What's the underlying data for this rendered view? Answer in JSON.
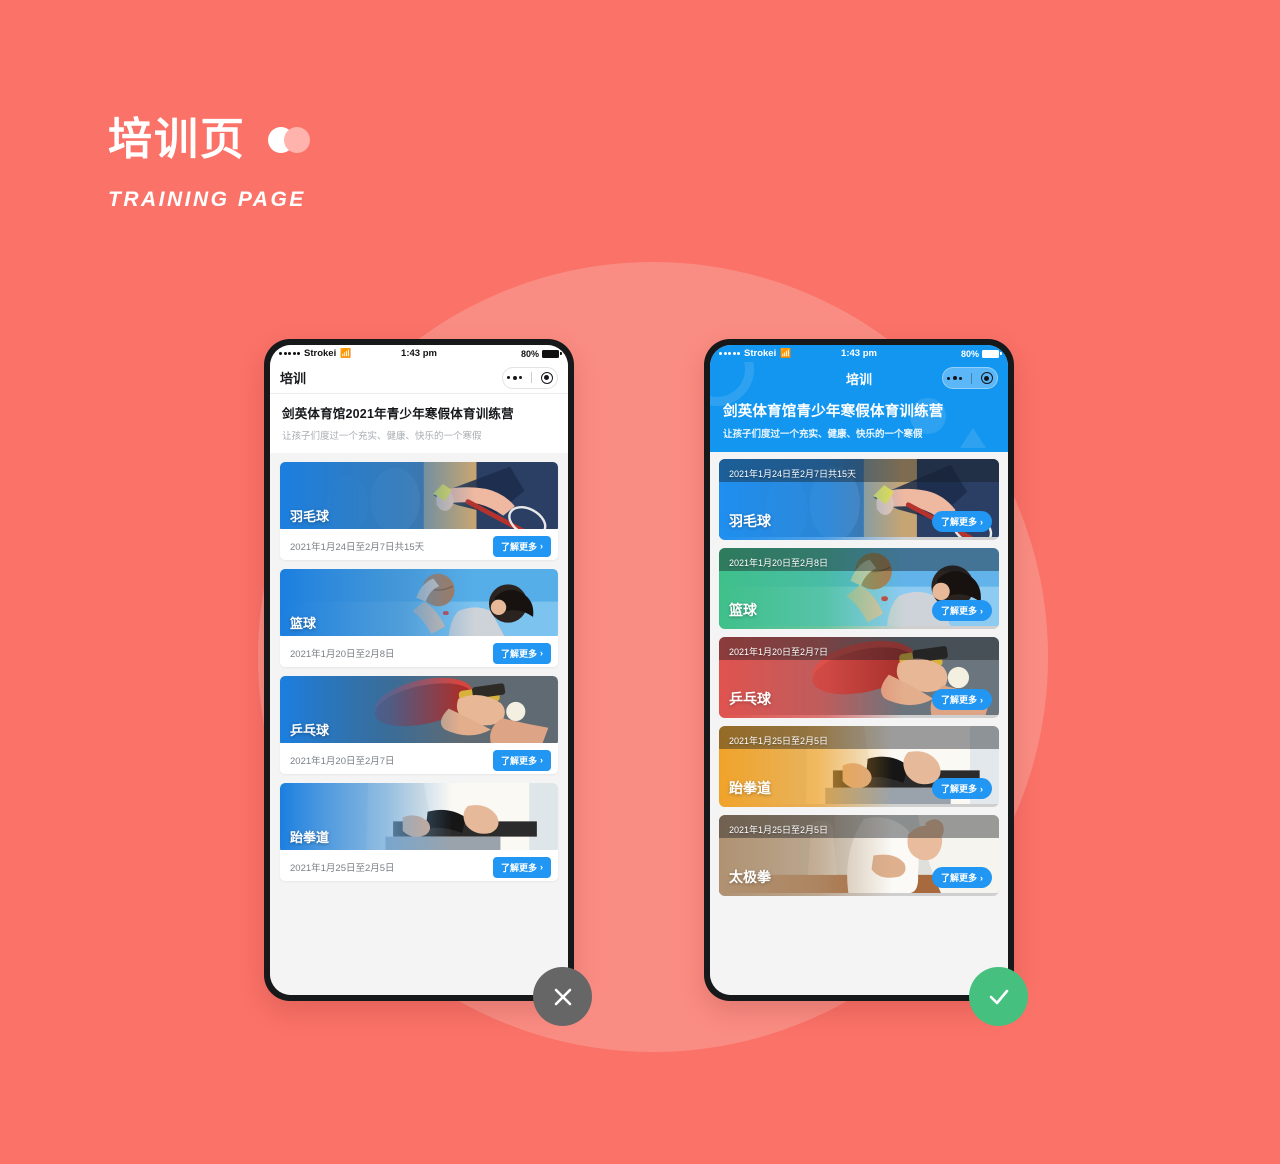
{
  "heading": {
    "title": "培训页",
    "subtitle": "TRAINING PAGE",
    "accent_color": "#fa7268",
    "circle_color": "#fa8d83"
  },
  "status_bar": {
    "carrier": "Strokei",
    "wifi_icon": "wifi-icon",
    "time": "1:43 pm",
    "battery": "80%"
  },
  "phone_left": {
    "nav": {
      "title": "培训",
      "capsule_more_icon": "more-dots-icon",
      "capsule_target_icon": "target-circle-icon"
    },
    "hero": {
      "title": "剑英体育馆2021年青少年寒假体育训练营",
      "subtitle": "让孩子们度过一个充实、健康、快乐的一个寒假"
    },
    "cards": [
      {
        "name": "羽毛球",
        "date": "2021年1月24日至2月7日共15天",
        "button": "了解更多",
        "chevron": "›"
      },
      {
        "name": "篮球",
        "date": "2021年1月20日至2月8日",
        "button": "了解更多",
        "chevron": "›"
      },
      {
        "name": "乒乓球",
        "date": "2021年1月20日至2月7日",
        "button": "了解更多",
        "chevron": "›"
      },
      {
        "name": "跆拳道",
        "date": "2021年1月25日至2月5日",
        "button": "了解更多",
        "chevron": "›"
      }
    ]
  },
  "phone_right": {
    "nav": {
      "title": "培训",
      "capsule_more_icon": "more-dots-icon",
      "capsule_target_icon": "target-circle-icon"
    },
    "hero": {
      "title": "剑英体育馆青少年寒假体育训练营",
      "subtitle": "让孩子们度过一个充实、健康、快乐的一个寒假",
      "background_color": "#1296f0"
    },
    "cards": [
      {
        "name": "羽毛球",
        "date": "2021年1月24日至2月7日共15天",
        "button": "了解更多",
        "chevron": "›",
        "tint": "#1f8ff0"
      },
      {
        "name": "篮球",
        "date": "2021年1月20日至2月8日",
        "button": "了解更多",
        "chevron": "›",
        "tint": "#3fc08a"
      },
      {
        "name": "乒乓球",
        "date": "2021年1月20日至2月7日",
        "button": "了解更多",
        "chevron": "›",
        "tint": "#e0534f"
      },
      {
        "name": "跆拳道",
        "date": "2021年1月25日至2月5日",
        "button": "了解更多",
        "chevron": "›",
        "tint": "#f0a32a"
      },
      {
        "name": "太极拳",
        "date": "2021年1月25日至2月5日",
        "button": "了解更多",
        "chevron": "›",
        "tint": "#b09272"
      }
    ]
  },
  "fabs": {
    "close_label": "close-icon",
    "close_color": "#666666",
    "check_label": "check-icon",
    "check_color": "#45c07f"
  }
}
